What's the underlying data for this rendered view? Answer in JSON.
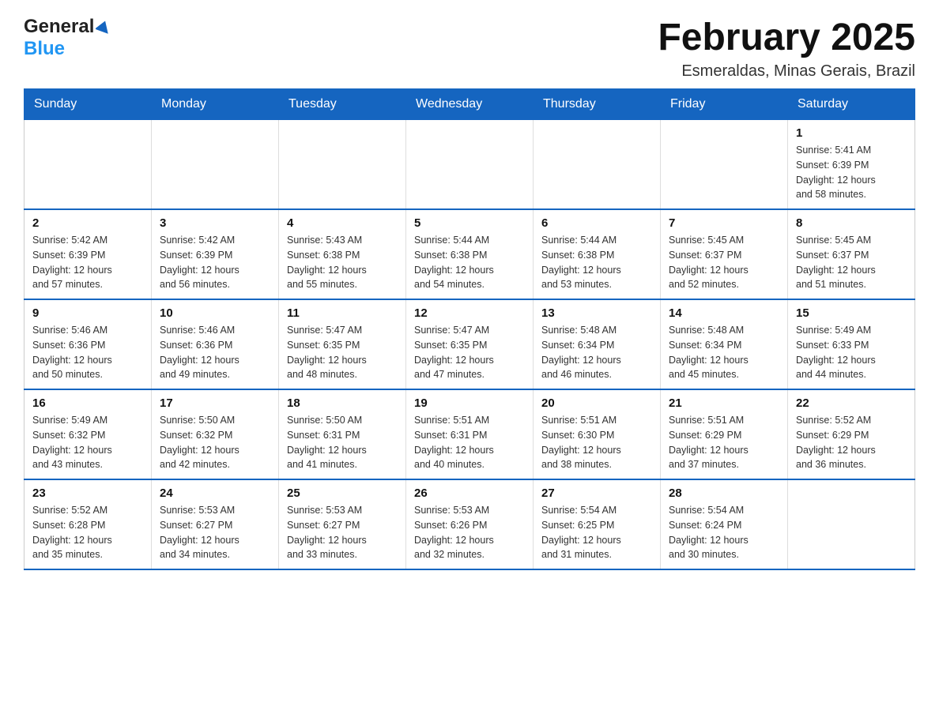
{
  "header": {
    "logo_general": "General",
    "logo_blue": "Blue",
    "month_title": "February 2025",
    "location": "Esmeraldas, Minas Gerais, Brazil"
  },
  "weekdays": [
    "Sunday",
    "Monday",
    "Tuesday",
    "Wednesday",
    "Thursday",
    "Friday",
    "Saturday"
  ],
  "weeks": [
    [
      {
        "day": "",
        "info": ""
      },
      {
        "day": "",
        "info": ""
      },
      {
        "day": "",
        "info": ""
      },
      {
        "day": "",
        "info": ""
      },
      {
        "day": "",
        "info": ""
      },
      {
        "day": "",
        "info": ""
      },
      {
        "day": "1",
        "info": "Sunrise: 5:41 AM\nSunset: 6:39 PM\nDaylight: 12 hours\nand 58 minutes."
      }
    ],
    [
      {
        "day": "2",
        "info": "Sunrise: 5:42 AM\nSunset: 6:39 PM\nDaylight: 12 hours\nand 57 minutes."
      },
      {
        "day": "3",
        "info": "Sunrise: 5:42 AM\nSunset: 6:39 PM\nDaylight: 12 hours\nand 56 minutes."
      },
      {
        "day": "4",
        "info": "Sunrise: 5:43 AM\nSunset: 6:38 PM\nDaylight: 12 hours\nand 55 minutes."
      },
      {
        "day": "5",
        "info": "Sunrise: 5:44 AM\nSunset: 6:38 PM\nDaylight: 12 hours\nand 54 minutes."
      },
      {
        "day": "6",
        "info": "Sunrise: 5:44 AM\nSunset: 6:38 PM\nDaylight: 12 hours\nand 53 minutes."
      },
      {
        "day": "7",
        "info": "Sunrise: 5:45 AM\nSunset: 6:37 PM\nDaylight: 12 hours\nand 52 minutes."
      },
      {
        "day": "8",
        "info": "Sunrise: 5:45 AM\nSunset: 6:37 PM\nDaylight: 12 hours\nand 51 minutes."
      }
    ],
    [
      {
        "day": "9",
        "info": "Sunrise: 5:46 AM\nSunset: 6:36 PM\nDaylight: 12 hours\nand 50 minutes."
      },
      {
        "day": "10",
        "info": "Sunrise: 5:46 AM\nSunset: 6:36 PM\nDaylight: 12 hours\nand 49 minutes."
      },
      {
        "day": "11",
        "info": "Sunrise: 5:47 AM\nSunset: 6:35 PM\nDaylight: 12 hours\nand 48 minutes."
      },
      {
        "day": "12",
        "info": "Sunrise: 5:47 AM\nSunset: 6:35 PM\nDaylight: 12 hours\nand 47 minutes."
      },
      {
        "day": "13",
        "info": "Sunrise: 5:48 AM\nSunset: 6:34 PM\nDaylight: 12 hours\nand 46 minutes."
      },
      {
        "day": "14",
        "info": "Sunrise: 5:48 AM\nSunset: 6:34 PM\nDaylight: 12 hours\nand 45 minutes."
      },
      {
        "day": "15",
        "info": "Sunrise: 5:49 AM\nSunset: 6:33 PM\nDaylight: 12 hours\nand 44 minutes."
      }
    ],
    [
      {
        "day": "16",
        "info": "Sunrise: 5:49 AM\nSunset: 6:32 PM\nDaylight: 12 hours\nand 43 minutes."
      },
      {
        "day": "17",
        "info": "Sunrise: 5:50 AM\nSunset: 6:32 PM\nDaylight: 12 hours\nand 42 minutes."
      },
      {
        "day": "18",
        "info": "Sunrise: 5:50 AM\nSunset: 6:31 PM\nDaylight: 12 hours\nand 41 minutes."
      },
      {
        "day": "19",
        "info": "Sunrise: 5:51 AM\nSunset: 6:31 PM\nDaylight: 12 hours\nand 40 minutes."
      },
      {
        "day": "20",
        "info": "Sunrise: 5:51 AM\nSunset: 6:30 PM\nDaylight: 12 hours\nand 38 minutes."
      },
      {
        "day": "21",
        "info": "Sunrise: 5:51 AM\nSunset: 6:29 PM\nDaylight: 12 hours\nand 37 minutes."
      },
      {
        "day": "22",
        "info": "Sunrise: 5:52 AM\nSunset: 6:29 PM\nDaylight: 12 hours\nand 36 minutes."
      }
    ],
    [
      {
        "day": "23",
        "info": "Sunrise: 5:52 AM\nSunset: 6:28 PM\nDaylight: 12 hours\nand 35 minutes."
      },
      {
        "day": "24",
        "info": "Sunrise: 5:53 AM\nSunset: 6:27 PM\nDaylight: 12 hours\nand 34 minutes."
      },
      {
        "day": "25",
        "info": "Sunrise: 5:53 AM\nSunset: 6:27 PM\nDaylight: 12 hours\nand 33 minutes."
      },
      {
        "day": "26",
        "info": "Sunrise: 5:53 AM\nSunset: 6:26 PM\nDaylight: 12 hours\nand 32 minutes."
      },
      {
        "day": "27",
        "info": "Sunrise: 5:54 AM\nSunset: 6:25 PM\nDaylight: 12 hours\nand 31 minutes."
      },
      {
        "day": "28",
        "info": "Sunrise: 5:54 AM\nSunset: 6:24 PM\nDaylight: 12 hours\nand 30 minutes."
      },
      {
        "day": "",
        "info": ""
      }
    ]
  ]
}
